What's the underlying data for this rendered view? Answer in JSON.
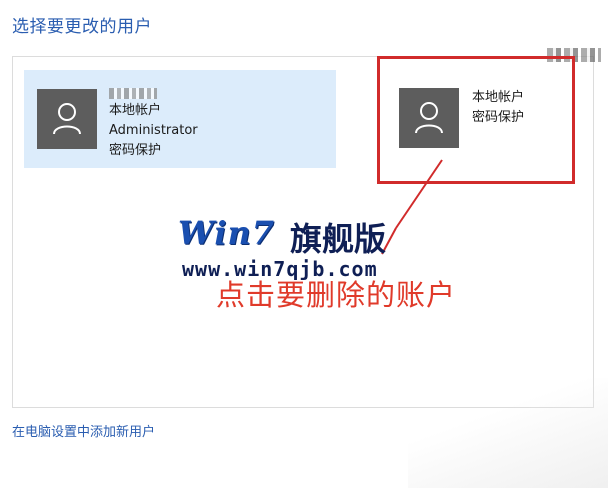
{
  "page": {
    "title": "选择要更改的用户"
  },
  "accounts": [
    {
      "type_label": "本地帐户",
      "name": "Administrator",
      "status": "密码保护",
      "selected": true
    },
    {
      "type_label": "本地帐户",
      "status": "密码保护",
      "selected": false
    }
  ],
  "watermark": {
    "brand": "Win7",
    "brand_cn": "旗舰版",
    "url": "www.win7qjb.com"
  },
  "annotation": {
    "text": "点击要删除的账户",
    "color": "#d12b2b"
  },
  "footer": {
    "add_user_link": "在电脑设置中添加新用户"
  },
  "colors": {
    "link_blue": "#2a5db0",
    "selected_bg": "#dcecfb",
    "avatar_gray": "#5d5d5d"
  }
}
